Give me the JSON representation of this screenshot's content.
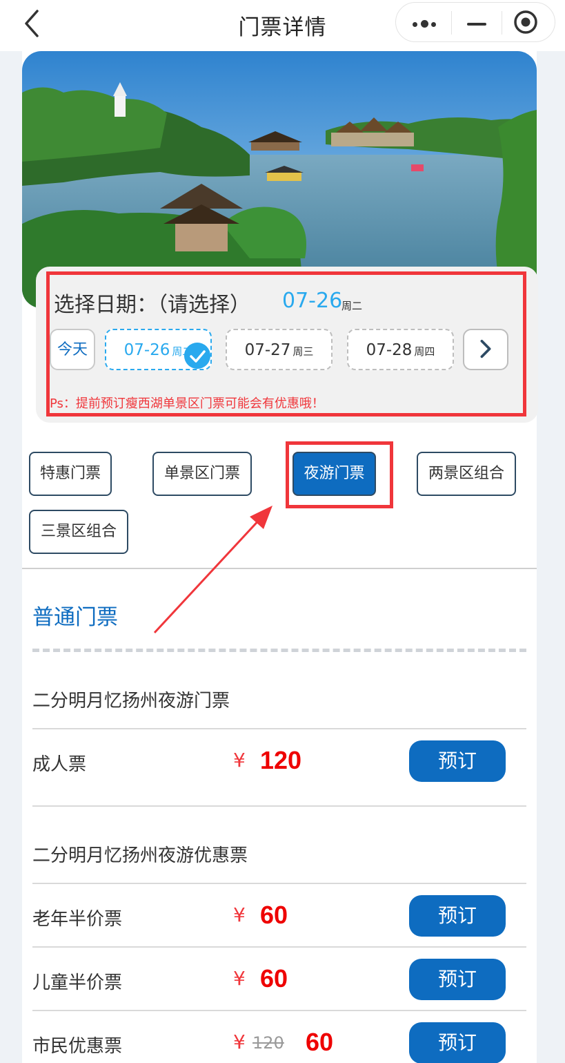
{
  "nav": {
    "title": "门票详情",
    "back_icon": "chevron-left-icon",
    "more_icon": "more-dots-icon",
    "minimize_icon": "minimize-icon",
    "close_icon": "record-circle-icon"
  },
  "hero": {
    "image": "lake-scenery-photo"
  },
  "date_picker": {
    "label": "选择日期：（请选择）",
    "selected_date": "07-26",
    "selected_weekday": "周二",
    "today_label": "今天",
    "dates": [
      {
        "date": "07-26",
        "weekday": "周二",
        "selected": true
      },
      {
        "date": "07-27",
        "weekday": "周三",
        "selected": false
      },
      {
        "date": "07-28",
        "weekday": "周四",
        "selected": false
      }
    ],
    "next_icon": "chevron-right-icon",
    "note": "Ps：提前预订瘦西湖单景区门票可能会有优惠哦！"
  },
  "tabs": [
    {
      "label": "特惠门票",
      "active": false
    },
    {
      "label": "单景区门票",
      "active": false
    },
    {
      "label": "夜游门票",
      "active": true
    },
    {
      "label": "两景区组合",
      "active": false
    },
    {
      "label": "三景区组合",
      "active": false
    }
  ],
  "section": {
    "title": "普通门票"
  },
  "groups": [
    {
      "title": "二分明月忆扬州夜游门票",
      "tickets": [
        {
          "name": "成人票",
          "currency": "¥",
          "price": "120",
          "book_label": "预订"
        }
      ]
    },
    {
      "title": "二分明月忆扬州夜游优惠票",
      "tickets": [
        {
          "name": "老年半价票",
          "currency": "¥",
          "price": "60",
          "book_label": "预订"
        },
        {
          "name": "儿童半价票",
          "currency": "¥",
          "price": "60",
          "book_label": "预订"
        },
        {
          "name": "市民优惠票",
          "currency": "¥",
          "original_price": "120",
          "price": "60",
          "book_label": "预订"
        }
      ]
    }
  ],
  "colors": {
    "primary": "#0e6cc0",
    "accent_light": "#29a9ee",
    "price_red": "#e00000",
    "annotation_red": "#f0363b"
  }
}
